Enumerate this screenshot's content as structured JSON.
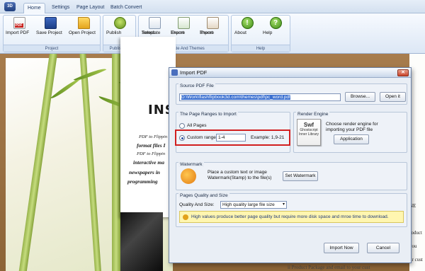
{
  "app": {
    "logo_text": "3D",
    "tabs": [
      {
        "label": "Home"
      },
      {
        "label": "Settings"
      },
      {
        "label": "Page Layout"
      },
      {
        "label": "Batch Convert"
      }
    ]
  },
  "ribbon": {
    "groups": [
      {
        "label": "Project"
      },
      {
        "label": "Publishing"
      },
      {
        "label": "Template  And Themes"
      },
      {
        "label": "Help"
      }
    ],
    "buttons": {
      "import_pdf": "Import PDF",
      "save_project": "Save Project",
      "open_project": "Open Project",
      "publish": "Publish",
      "select_template_1": "Select",
      "select_template_2": "Template",
      "export_theme_1": "Export",
      "export_theme_2": "Theme",
      "import_theme_1": "Import",
      "import_theme_2": "Theme",
      "about": "About",
      "help": "Help"
    }
  },
  "preview": {
    "title": "INS",
    "lines": [
      "PDF to Flippin",
      "format files I",
      "PDF to Flippin",
      "interactive ma",
      "newspapers in",
      "programming"
    ],
    "right_lines": [
      "NE",
      "roduct",
      "you",
      "ur cust",
      "ii Product Package and email to your cust"
    ]
  },
  "dialog": {
    "title": "Import PDF",
    "close": "✕",
    "source": {
      "legend": "Source PDF File",
      "path": "D:\\Work\\flashflipbook3d.com\\themes\\pdf\\pc_word.pdf",
      "browse": "Browse...",
      "open": "Open it"
    },
    "ranges": {
      "legend": "The Page Ranges to Import",
      "all_pages": "All Pages",
      "custom_range": "Custom range:",
      "custom_value": "1-4",
      "example": "Example: 1,9-21",
      "selected": "custom"
    },
    "engine": {
      "legend": "Render Engine",
      "image_title": "Swf",
      "image_sub1": "Ghostscript",
      "image_sub2": "Inner Library",
      "description1": "Choose render engine for",
      "description2": "importing your PDF file",
      "button": "Application"
    },
    "watermark": {
      "legend": "Watermark",
      "text1": "Place a custom text or image",
      "text2": "Watermark(Stamp) to the file(s)",
      "button": "Set Watermark"
    },
    "quality": {
      "legend": "Pages Quality and Size",
      "label": "Quality And Size:",
      "selected": "High quality large file size",
      "note": "High values produce better page quality but require more disk space and mroe time to download."
    },
    "footer": {
      "import_now": "Import Now",
      "cancel": "Cancel"
    }
  },
  "colors": {
    "highlight": "#d11f1f",
    "selection": "#3a6fd0",
    "note_bg": "#fff6b0"
  }
}
